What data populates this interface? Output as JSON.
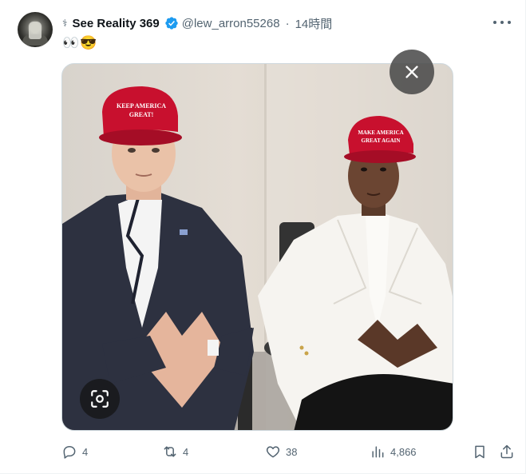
{
  "post": {
    "display_name": "See Reality 369",
    "mini_logo": "⚕︎",
    "handle": "@lew_arron55268",
    "separator": "·",
    "time": "14時間",
    "text": "👀😎",
    "verified": true
  },
  "media": {
    "hat_left_text_line1": "KEEP AMERICA",
    "hat_left_text_line2": "GREAT!",
    "hat_right_text_line1": "MAKE AMERICA",
    "hat_right_text_line2": "GREAT AGAIN",
    "hat_color": "#c8102e"
  },
  "actions": {
    "replies": "4",
    "reposts": "4",
    "likes": "38",
    "views": "4,866"
  },
  "colors": {
    "text_primary": "#0f1419",
    "text_secondary": "#536471",
    "verified_blue": "#1d9bf0"
  },
  "icons": {
    "avatar": "avatar-photo",
    "verified": "verified-badge-icon",
    "more": "more-options-icon",
    "close": "close-icon",
    "lens": "visual-search-icon",
    "reply": "reply-icon",
    "repost": "repost-icon",
    "like": "like-icon",
    "views": "views-icon",
    "bookmark": "bookmark-icon",
    "share": "share-icon"
  }
}
